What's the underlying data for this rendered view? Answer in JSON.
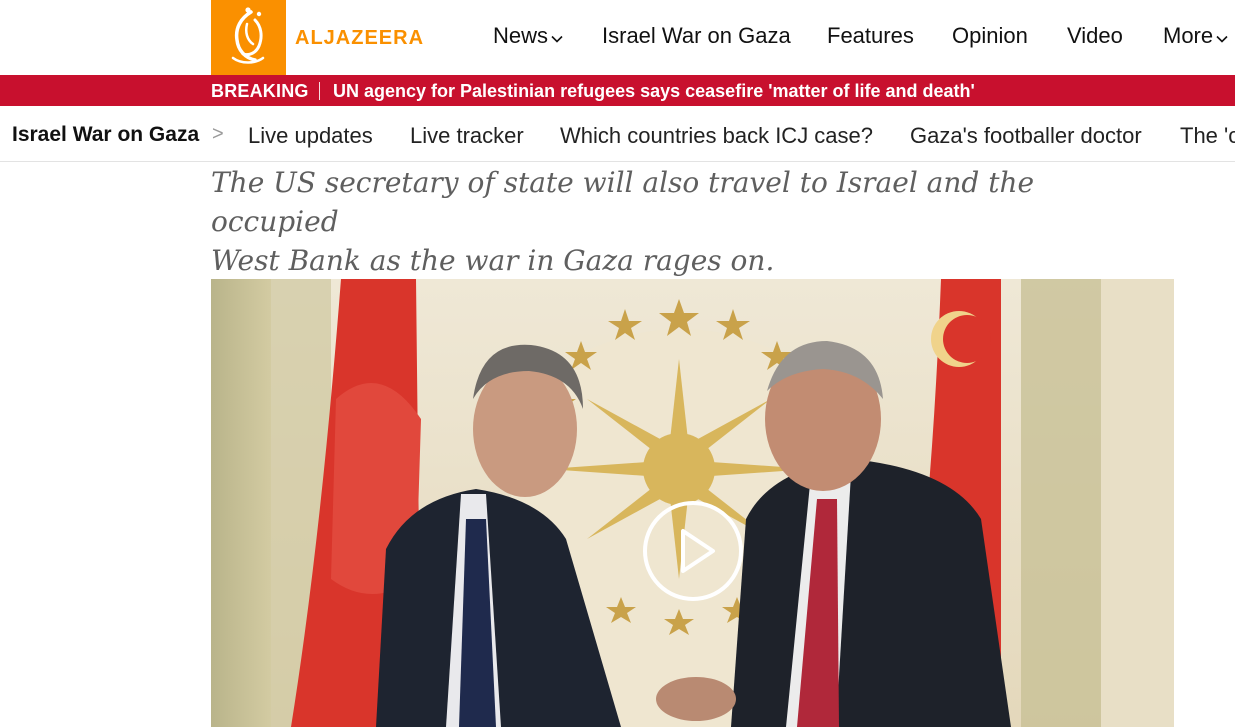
{
  "brand": {
    "logo_text": "ALJAZEERA",
    "accent": "#fa9000"
  },
  "nav": {
    "items": [
      {
        "label": "News",
        "has_dropdown": true
      },
      {
        "label": "Israel War on Gaza",
        "has_dropdown": false
      },
      {
        "label": "Features",
        "has_dropdown": false
      },
      {
        "label": "Opinion",
        "has_dropdown": false
      },
      {
        "label": "Video",
        "has_dropdown": false
      },
      {
        "label": "More",
        "has_dropdown": true
      }
    ]
  },
  "breaking": {
    "label": "BREAKING",
    "headline": "UN agency for Palestinian refugees says ceasefire 'matter of life and death'",
    "color": "#c8102e"
  },
  "subnav": {
    "title": "Israel War on Gaza",
    "arrow": ">",
    "links": [
      "Live updates",
      "Live tracker",
      "Which countries back ICJ case?",
      "Gaza's footballer doctor",
      "The 'c"
    ]
  },
  "article": {
    "standfirst_line1": "The US secretary of state will also travel to Israel and the occupied",
    "standfirst_line2": "West Bank as the war in Gaza rages on.",
    "hero": {
      "play_icon": "play-icon"
    }
  },
  "icons": {
    "logo": "aljazeera-logo-icon",
    "dropdown": "chevron-down-icon",
    "play": "play-icon"
  }
}
